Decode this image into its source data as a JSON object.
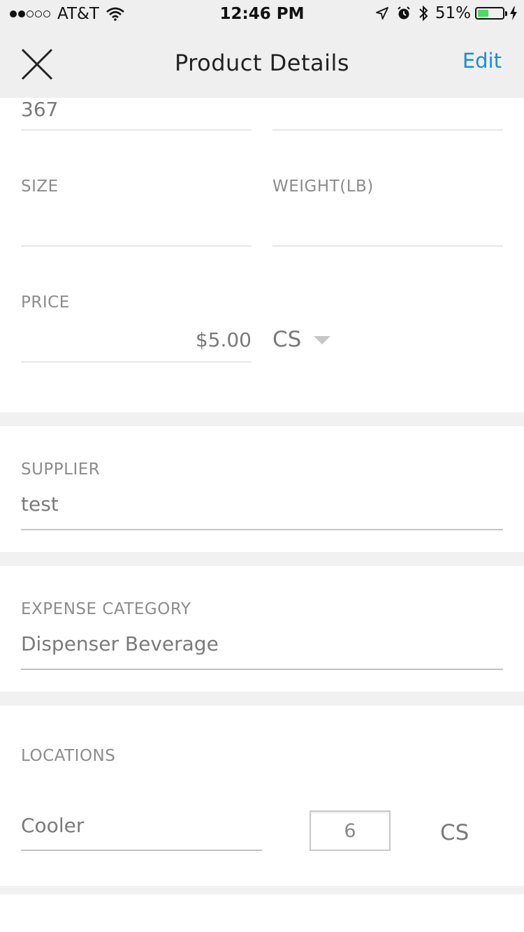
{
  "status_bar": {
    "carrier": "AT&T",
    "time": "12:46 PM",
    "battery_percent": "51%",
    "battery_level": 0.51,
    "signal_bars_filled": 2,
    "signal_bars_total": 5
  },
  "nav": {
    "title": "Product Details",
    "edit_label": "Edit",
    "close_icon": "close-icon"
  },
  "fields": {
    "top_value": "367",
    "size_label": "SIZE",
    "size_value": "",
    "weight_label": "WEIGHT(LB)",
    "weight_value": "",
    "price_label": "PRICE",
    "price_value": "$5.00",
    "price_unit": "CS"
  },
  "supplier": {
    "label": "SUPPLIER",
    "value": "test"
  },
  "expense": {
    "label": "EXPENSE CATEGORY",
    "value": "Dispenser Beverage"
  },
  "locations": {
    "label": "LOCATIONS",
    "items": [
      {
        "name": "Cooler",
        "quantity": "6",
        "unit": "CS"
      }
    ]
  },
  "colors": {
    "accent": "#1a8fd0",
    "header_bg": "#efefef",
    "battery_fill": "#4cd964"
  }
}
